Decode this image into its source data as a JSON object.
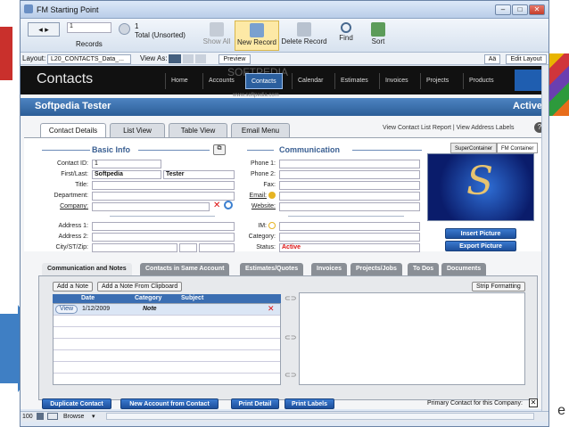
{
  "window": {
    "title": "FM Starting Point"
  },
  "toolbar": {
    "record_number": "1",
    "records_label": "Records",
    "total_count": "1",
    "total_label": "Total (Unsorted)",
    "show_all": "Show All",
    "new_record": "New Record",
    "delete_record": "Delete Record",
    "find": "Find",
    "sort": "Sort"
  },
  "layoutbar": {
    "layout_label": "Layout:",
    "layout_value": "L20_CONTACTS_Data_...",
    "view_as_label": "View As:",
    "preview": "Preview",
    "aa": "Aä",
    "edit_layout": "Edit Layout"
  },
  "nav": {
    "title": "Contacts",
    "watermark": "SOFTPEDIA",
    "watermark_url": "www.softpedia.com",
    "items": [
      "Home",
      "Accounts",
      "Contacts",
      "Calendar",
      "Estimates",
      "Invoices",
      "Projects",
      "Products"
    ]
  },
  "record": {
    "name": "Softpedia Tester",
    "status_right": "Active"
  },
  "tabs": [
    "Contact Details",
    "List View",
    "Table View",
    "Email Menu"
  ],
  "view_links": "View Contact List Report  |  View Address Labels",
  "help_icon": "?",
  "basic_info": {
    "heading": "Basic Info",
    "contact_id_label": "Contact ID:",
    "contact_id": "1",
    "first_last_label": "First/Last:",
    "first": "Softpedia",
    "last": "Tester",
    "title_label": "Title:",
    "department_label": "Department:",
    "company_label": "Company:",
    "address1_label": "Address 1:",
    "address2_label": "Address 2:",
    "city_label": "City/ST/Zip:"
  },
  "communication": {
    "heading": "Communication",
    "phone1_label": "Phone 1:",
    "phone2_label": "Phone 2:",
    "fax_label": "Fax:",
    "email_label": "Email:",
    "website_label": "Website:",
    "im_label": "IM:",
    "category_label": "Category:",
    "status_label": "Status:",
    "status_value": "Active"
  },
  "container_tabs": [
    "SuperContainer",
    "FM Container"
  ],
  "insert_picture": "Insert Picture",
  "export_picture": "Export Picture",
  "bottom_tabs": [
    "Communication and Notes",
    "Contacts in Same Account",
    "Estimates/Quotes",
    "Invoices",
    "Projects/Jobs",
    "To Dos",
    "Documents"
  ],
  "notes": {
    "add_note": "Add a Note",
    "add_clipboard": "Add a Note From Clipboard",
    "strip_formatting": "Strip Formatting",
    "columns": [
      "Date",
      "Category",
      "Subject"
    ],
    "rows": [
      {
        "view": "View",
        "date": "1/12/2009",
        "category": "Note"
      }
    ]
  },
  "footer": {
    "duplicate": "Duplicate Contact",
    "new_account": "New Account from Contact",
    "print_detail": "Print Detail",
    "print_labels": "Print Labels",
    "primary_label": "Primary Contact for this Company:"
  },
  "statusbar": {
    "zoom": "100",
    "mode": "Browse"
  }
}
